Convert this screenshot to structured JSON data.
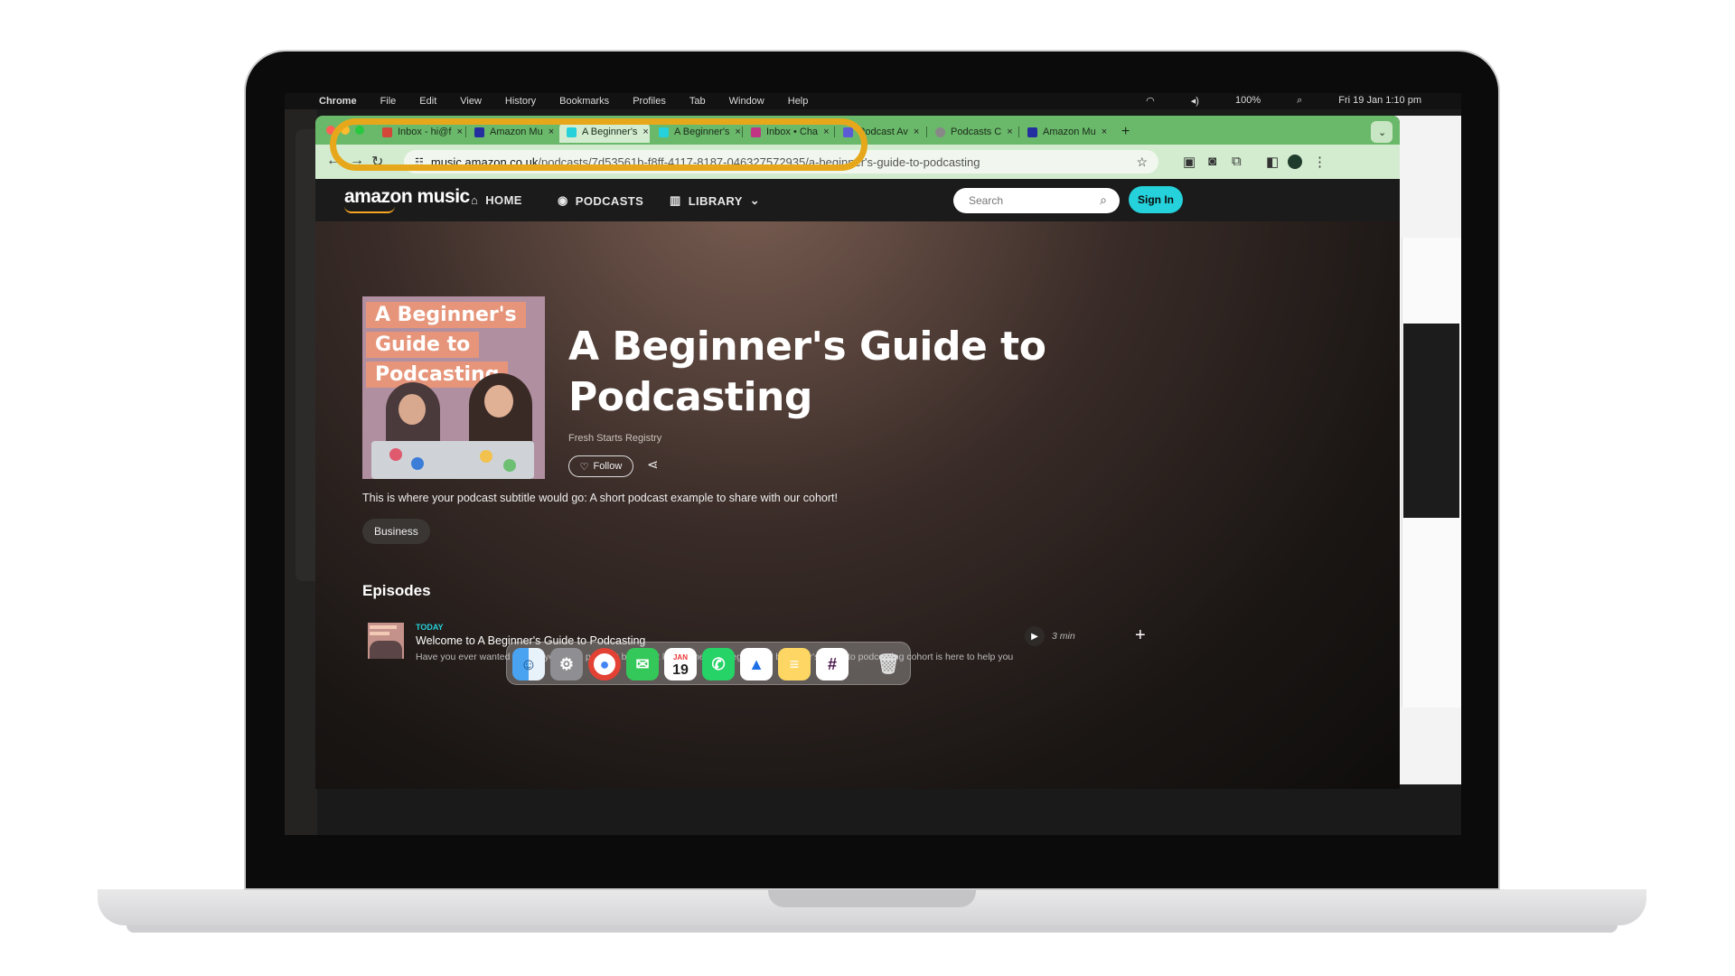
{
  "menubar": {
    "app": "Chrome",
    "items": [
      "File",
      "Edit",
      "View",
      "History",
      "Bookmarks",
      "Profiles",
      "Tab",
      "Window",
      "Help"
    ],
    "battery": "100%",
    "datetime": "Fri 19 Jan 1:10 pm"
  },
  "tabs": [
    {
      "label": "Inbox - hi@f",
      "color": "#d44638"
    },
    {
      "label": "Amazon Mu",
      "color": "#232f9e"
    },
    {
      "label": "A Beginner's",
      "color": "#25d1da"
    },
    {
      "label": "A Beginner's",
      "color": "#25d1da"
    },
    {
      "label": "Inbox • Cha",
      "color": "#c13584"
    },
    {
      "label": "Podcast Av",
      "color": "#5b5bd6"
    },
    {
      "label": "Podcasts C",
      "color": "#888888"
    },
    {
      "label": "Amazon Mu",
      "color": "#232f9e"
    }
  ],
  "omnibox": {
    "host": "music.amazon.co.uk",
    "path": "/podcasts/7d53561b-f8ff-4117-8187-046327572935/a-beginner's-guide-to-podcasting"
  },
  "nav": {
    "logo": "amazon music",
    "home": "HOME",
    "podcasts": "PODCASTS",
    "library": "LIBRARY",
    "search_placeholder": "Search",
    "signin": "Sign In"
  },
  "cover": {
    "line1": "A Beginner's",
    "line2": "Guide to",
    "line3": "Podcasting"
  },
  "podcast": {
    "title": "A Beginner's Guide to Podcasting",
    "author": "Fresh Starts Registry",
    "follow": "Follow",
    "subtitle": "This is where your podcast subtitle would go: A short podcast example to share with our cohort!",
    "tag": "Business"
  },
  "episodes": {
    "heading": "Episodes",
    "items": [
      {
        "date": "TODAY",
        "title": "Welcome to A Beginner's Guide to Podcasting",
        "description": "Have you ever wanted to start your own podcast but didn't know where to begin? Our beginner's guide to podcasting cohort is here to help you",
        "duration": "3 min"
      }
    ]
  },
  "dock": {
    "calendar_month": "JAN",
    "calendar_day": "19"
  },
  "colors": {
    "highlight": "#e6a81a",
    "accent": "#25d1da"
  }
}
